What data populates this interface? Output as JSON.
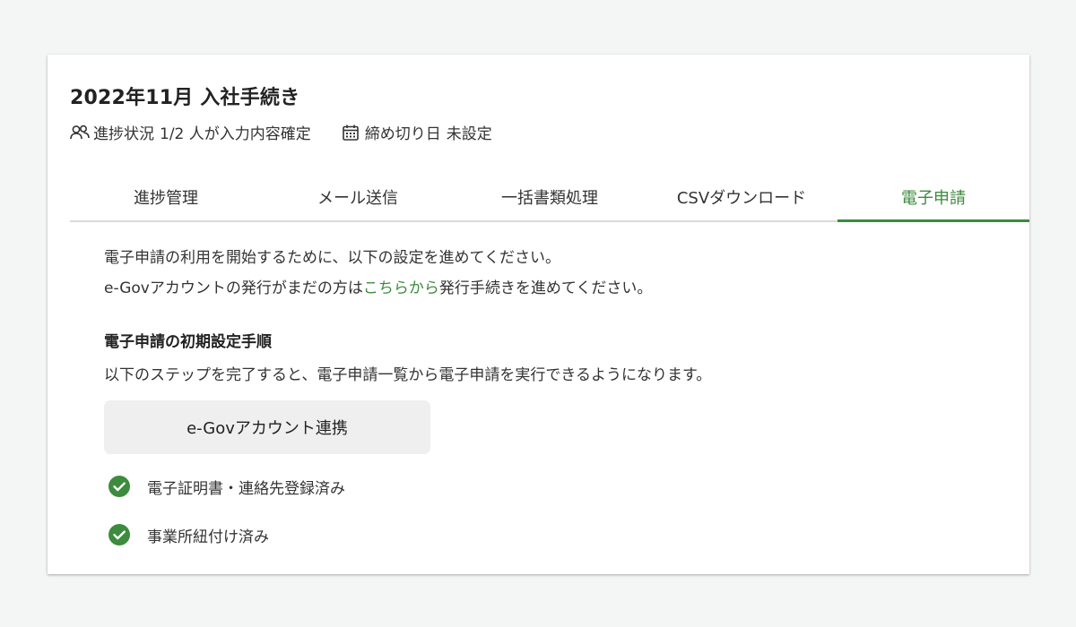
{
  "header": {
    "title": "2022年11月 入社手続き",
    "progress_label": "進捗状況",
    "progress_value": "1/2 人が入力内容確定",
    "deadline_label": "締め切り日",
    "deadline_value": "未設定"
  },
  "tabs": [
    {
      "label": "進捗管理",
      "active": false
    },
    {
      "label": "メール送信",
      "active": false
    },
    {
      "label": "一括書類処理",
      "active": false
    },
    {
      "label": "CSVダウンロード",
      "active": false
    },
    {
      "label": "電子申請",
      "active": true
    }
  ],
  "intro": {
    "line1": "電子申請の利用を開始するために、以下の設定を進めてください。",
    "line2_prefix": "e-Govアカウントの発行がまだの方は",
    "line2_link": "こちらから",
    "line2_suffix": "発行手続きを進めてください。"
  },
  "setup": {
    "title": "電子申請の初期設定手順",
    "description": "以下のステップを完了すると、電子申請一覧から電子申請を実行できるようになります。",
    "button_label": "e-Govアカウント連携",
    "checklist": [
      {
        "label": "電子証明書・連絡先登録済み",
        "icon": "check-circle-icon"
      },
      {
        "label": "事業所紐付け済み",
        "icon": "check-circle-icon"
      }
    ]
  },
  "colors": {
    "accent": "#3c8b3e",
    "background": "#f4f5f5",
    "card": "#ffffff",
    "button_bg": "#efefef"
  }
}
